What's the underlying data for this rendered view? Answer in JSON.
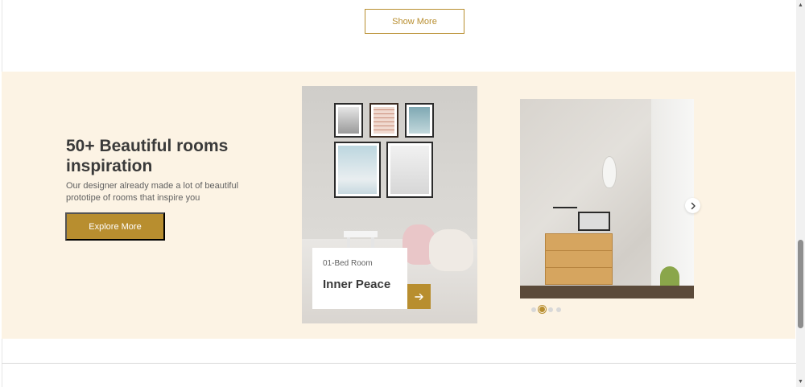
{
  "products_section": {
    "show_more_label": "Show More"
  },
  "inspiration": {
    "title": "50+ Beautiful rooms inspiration",
    "description": "Our designer already made a lot of beautiful prototipe of rooms that inspire you",
    "explore_label": "Explore More",
    "featured_room": {
      "subtitle": "01-Bed Room",
      "name": "Inner Peace",
      "arrow_icon": "arrow-right-icon"
    },
    "slider": {
      "next_icon": "chevron-right-icon",
      "dot_count": 4,
      "active_dot": 2
    }
  },
  "colors": {
    "accent": "#b88e2f",
    "band_bg": "#fcf3e4"
  }
}
